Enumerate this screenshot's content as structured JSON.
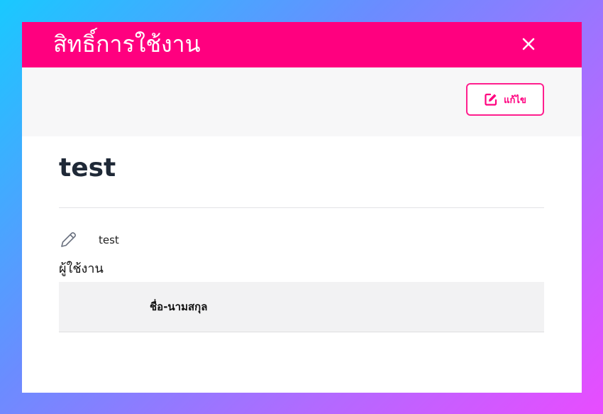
{
  "modal": {
    "title": "สิทธิ์การใช้งาน",
    "close_icon": "close-icon",
    "edit_label": "แก้ไข",
    "edit_icon": "edit-square-icon"
  },
  "role": {
    "name": "test",
    "description": "test",
    "description_icon": "pencil-icon"
  },
  "users": {
    "heading": "ผู้ใช้งาน",
    "columns": [
      "ชื่อ-นามสกุล"
    ]
  },
  "colors": {
    "header_bg": "#ff007f",
    "accent": "#ff1f8e",
    "toolbar_bg": "#f7f7f8",
    "table_header_bg": "#f2f2f3",
    "title_text": "#1f2937"
  }
}
